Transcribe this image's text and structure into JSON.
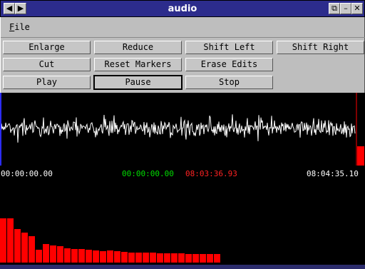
{
  "window": {
    "title": "audio"
  },
  "menu": {
    "file_prefix": "F",
    "file_rest": "ile"
  },
  "buttons": {
    "enlarge": "Enlarge",
    "reduce": "Reduce",
    "shift_left": "Shift Left",
    "shift_right": "Shift Right",
    "cut": "Cut",
    "reset_markers": "Reset Markers",
    "erase_edits": "Erase Edits",
    "play": "Play",
    "pause": "Pause",
    "stop": "Stop"
  },
  "times": {
    "start": "00:00:00.00",
    "marker_a": "00:00:00.00",
    "marker_b": "08:03:36.93",
    "end": "08:04:35.10"
  },
  "colors": {
    "waveform": "#ffffff",
    "marker_a": "#00dd00",
    "marker_b": "#ff2222",
    "bars": "#ff0000",
    "start_marker": "#2c2cff",
    "end_marker": "#ff0000"
  },
  "level_bars": [
    0.62,
    0.62,
    0.47,
    0.42,
    0.37,
    0.18,
    0.26,
    0.24,
    0.23,
    0.2,
    0.19,
    0.19,
    0.18,
    0.17,
    0.16,
    0.17,
    0.16,
    0.15,
    0.14,
    0.14,
    0.14,
    0.14,
    0.13,
    0.13,
    0.13,
    0.13,
    0.12,
    0.12,
    0.12,
    0.12,
    0.12
  ]
}
